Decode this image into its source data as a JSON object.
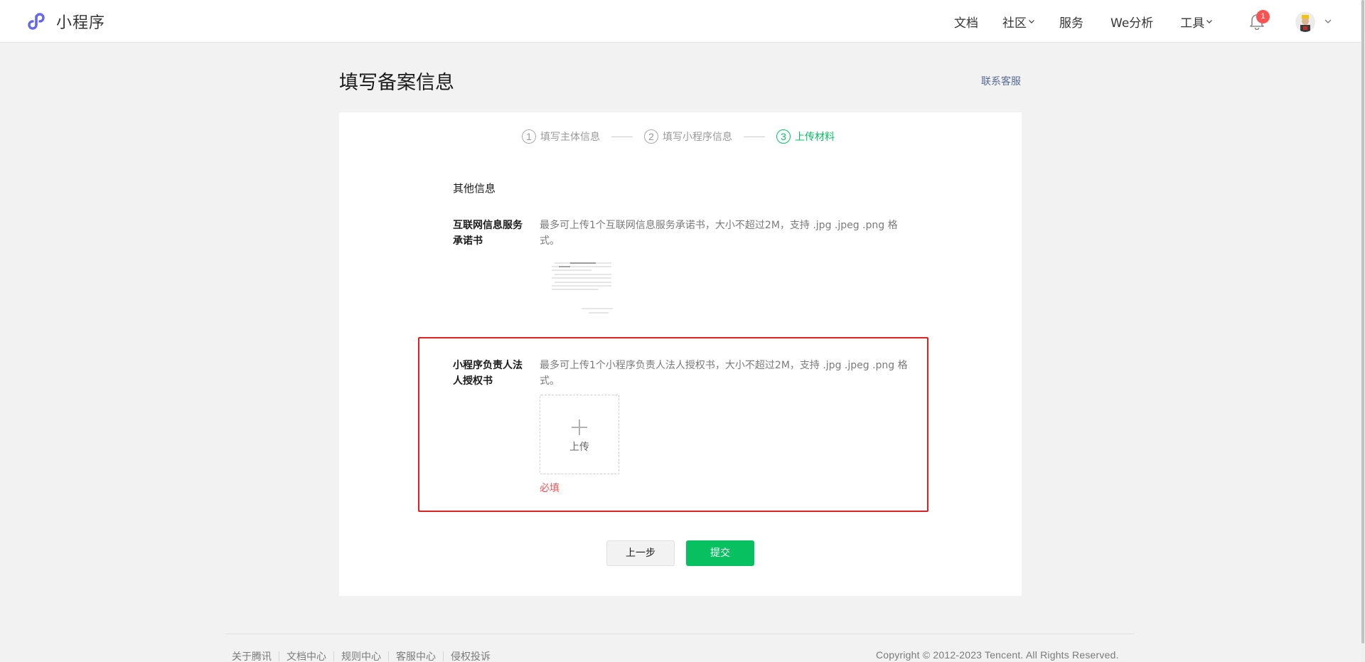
{
  "brand": {
    "name": "小程序"
  },
  "nav": {
    "items": [
      "文档",
      "社区",
      "服务",
      "We分析",
      "工具"
    ],
    "notification_count": "1"
  },
  "page": {
    "title": "填写备案信息",
    "contact_link": "联系客服"
  },
  "steps": [
    {
      "num": "1",
      "label": "填写主体信息"
    },
    {
      "num": "2",
      "label": "填写小程序信息"
    },
    {
      "num": "3",
      "label": "上传材料"
    }
  ],
  "section": {
    "title": "其他信息"
  },
  "rows": {
    "internet_commitment": {
      "label": "互联网信息服务承诺书",
      "desc": "最多可上传1个互联网信息服务承诺书，大小不超过2M，支持 .jpg .jpeg .png 格式。"
    },
    "authorization": {
      "label": "小程序负责人法人授权书",
      "desc": "最多可上传1个小程序负责人法人授权书，大小不超过2M，支持 .jpg .jpeg .png 格式。",
      "upload_label": "上传",
      "required_text": "必填"
    }
  },
  "buttons": {
    "prev": "上一步",
    "submit": "提交"
  },
  "footer": {
    "links": [
      "关于腾讯",
      "文档中心",
      "规则中心",
      "客服中心",
      "侵权投诉"
    ],
    "copyright": "Copyright © 2012-2023 Tencent. All Rights Reserved."
  },
  "colors": {
    "accent": "#07c160",
    "error": "#fa5151",
    "highlight": "#e02020",
    "link": "#576b95"
  },
  "icons": {
    "brand": "miniprogram-logo-icon",
    "bell": "bell-icon",
    "chevron": "chevron-down-icon",
    "plus": "plus-icon"
  }
}
